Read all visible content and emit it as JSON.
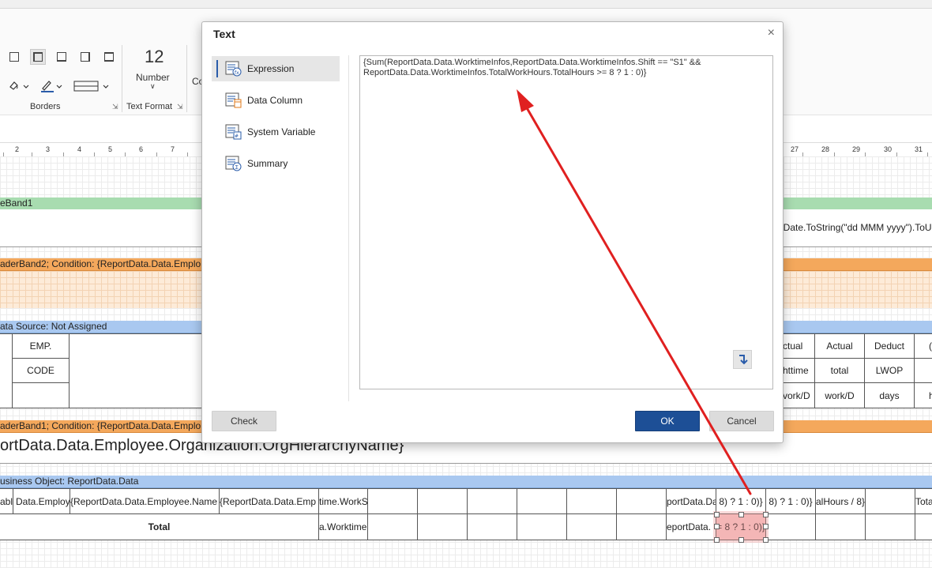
{
  "ribbon": {
    "font_size_value": "12",
    "number_label": "Number",
    "truncated_label": "Co",
    "borders_group": "Borders",
    "text_format_group": "Text Format"
  },
  "ruler": {
    "left_ticks": [
      "2",
      "3",
      "4",
      "5",
      "6",
      "7"
    ],
    "right_ticks": [
      "27",
      "28",
      "29",
      "30",
      "31"
    ]
  },
  "report": {
    "band1": "eBand1",
    "date_expr": "nDate.ToString(\"dd MMM yyyy\").ToU",
    "header_band2": "aderBand2; Condition: {ReportData.Data.Emplo",
    "data_source": "ata Source: Not Assigned",
    "emp_label": "EMP.",
    "code_label": "CODE",
    "right_headers": {
      "row1": [
        "ctual",
        "Actual",
        "Deduct",
        "("
      ],
      "row2": [
        "httime",
        "total",
        "LWOP",
        ""
      ],
      "row3": [
        "vork/D",
        "work/D",
        "days",
        "h"
      ]
    },
    "header_band1": "aderBand1; Condition: {ReportData.Data.Emplo",
    "org_name": "ortData.Data.Employee.Organization.OrgHierarchyName}",
    "business_object": "usiness Object: ReportData.Data",
    "row_cells": [
      "able",
      "Data.Employ",
      "{ReportData.Data.Employee.Name",
      "{ReportData.Data.Emp",
      "time.WorkS"
    ],
    "row_right": [
      "portData.Dat",
      "8) ? 1 : 0)}",
      "8) ? 1 : 0)}",
      "alHours / 8}",
      "",
      "Tota"
    ],
    "total_label": "Total",
    "total_cells": [
      "a.Worktime.T",
      "eportData.",
      "= 8 ? 1 : 0)}"
    ]
  },
  "dialog": {
    "title": "Text",
    "close_symbol": "×",
    "nav": [
      "Expression",
      "Data Column",
      "System Variable",
      "Summary"
    ],
    "expression": "{Sum(ReportData.Data.WorktimeInfos,ReportData.Data.WorktimeInfos.Shift == \"S1\" && ReportData.Data.WorktimeInfos.TotalWorkHours.TotalHours >= 8 ? 1 : 0)}",
    "check_button": "Check",
    "ok_button": "OK",
    "cancel_button": "Cancel"
  },
  "colors": {
    "annotation_arrow": "#e02020",
    "ok_button": "#1d4f96",
    "band_green": "#a8dcb0",
    "band_orange": "#f4a85c",
    "band_blue": "#a9c8f0"
  }
}
